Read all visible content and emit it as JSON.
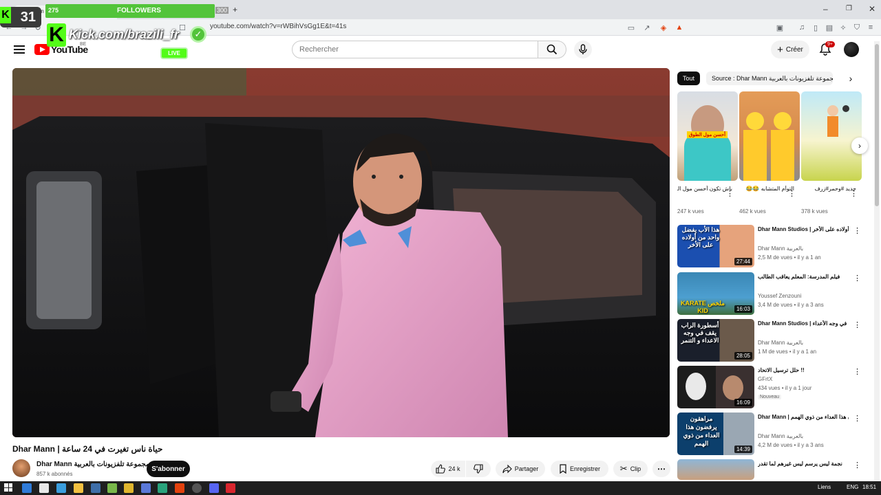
{
  "browser": {
    "tab_title": "Stream",
    "url": "youtube.com/watch?v=rWBihVsGg1E&t=41s"
  },
  "overlay": {
    "badge_count": "31",
    "followers_count": "275",
    "followers_label": "FOLLOWERS",
    "followers_goal": "300",
    "handle": "Kick.com/brazili_fr",
    "live_label": "LIVE"
  },
  "header": {
    "logo_text": "YouTube",
    "logo_region": "BE",
    "search_placeholder": "Rechercher",
    "create_label": "Créer",
    "notifications_badge": "9+"
  },
  "video": {
    "title": "Dhar Mann | حياة ناس تغيرت في 24 ساعة",
    "channel_name": "Dhar Mann مجموعة تلفزيونات بالعربية",
    "subscribers": "857 k abonnés",
    "subscribe_label": "S'abonner",
    "likes": "24 k",
    "share_label": "Partager",
    "save_label": "Enregistrer",
    "clip_label": "Clip"
  },
  "sidebar": {
    "chips": [
      "Tout",
      "Source : Dhar Mann مجموعة تلفزيونات بالعربية"
    ],
    "shorts": [
      {
        "title": "باش تكون أحسن مول الطوق",
        "views": "247 k vues"
      },
      {
        "title": "التوأم المتشابه 😂😂",
        "views": "462 k vues"
      },
      {
        "title": "جديد #وحمر#زرف",
        "views": "378 k vues"
      }
    ],
    "recommendations": [
      {
        "title": "Dhar Mann Studios | هذا الأب يفضل واحد من أولاده على الأخر",
        "channel": "Dhar Mann بالعربية",
        "stats": "2,5 M de vues • il y a 1 an",
        "duration": "27:44",
        "thumb_text": "هذا الأب يفضل واحد من أولاده على الأخر"
      },
      {
        "title": "فيلم المدرسة: المعلم يعاقب الطالب",
        "channel": "Youssef Zenzouni",
        "stats": "3,4 M de vues • il y a 3 ans",
        "duration": "16:03",
        "thumb_text": "ملخص KARATE KID"
      },
      {
        "title": "Dhar Mann Studios | أسطورة الراب يقف في وجه الأعداء",
        "channel": "Dhar Mann بالعربية",
        "stats": "1 M de vues • il y a 1 an",
        "duration": "28:05",
        "thumb_text": "أسطورة الراب يقف في وجه الاعداء و التنمر"
      },
      {
        "title": "حلل ترسيل الاتحاد !!",
        "channel": "GFrtX",
        "stats": "434 vues • il y a 1 jour",
        "duration": "16:09",
        "thumb_text": "",
        "badge": "Nouveau"
      },
      {
        "title": "Dhar Mann | مراهقون يرفضون هذا العداء من ذوي الهمم",
        "channel": "Dhar Mann بالعربية",
        "stats": "4,2 M de vues • il y a 3 ans",
        "duration": "14:39",
        "thumb_text": "مراهقون يرفضون هذا العداء من ذوي الهمم"
      },
      {
        "title": "نجمة ليس يرسم ليس غيرهم لما تقدر",
        "channel": "",
        "stats": "",
        "duration": "",
        "thumb_text": ""
      }
    ]
  },
  "taskbar": {
    "label": "Liens",
    "lang": "ENG",
    "time": "18:51"
  },
  "colors": {
    "kick_green": "#53fc18",
    "yt_red": "#ff0000",
    "shirt_pink": "#e7a3c9"
  }
}
